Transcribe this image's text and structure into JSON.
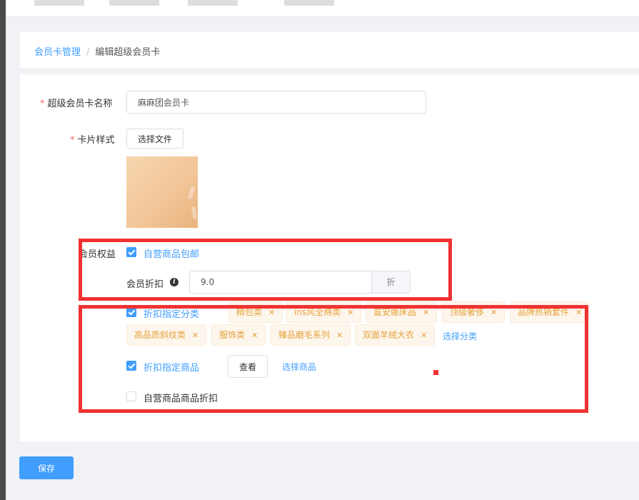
{
  "breadcrumb": {
    "parent": "会员卡管理",
    "separator": "/",
    "current": "编辑超级会员卡"
  },
  "form": {
    "required_mark": "*",
    "name_label": "超级会员卡名称",
    "name_value": "麻麻团会员卡",
    "style_label": "卡片样式",
    "choose_file_label": "选择文件",
    "benefits_label": "会员权益",
    "free_shipping": {
      "label": "自营商品包邮",
      "checked": true
    },
    "discount_label": "会员折扣",
    "info_icon_glyph": "i",
    "discount_value": "9.0",
    "discount_suffix": "折",
    "category_discount": {
      "label": "折扣指定分类",
      "checked": true
    },
    "category_tags": [
      "精包类",
      "ins风全棉类",
      "富安娜床品",
      "顶级奢侈",
      "品牌热销套件",
      "高品质斜纹类",
      "服饰类",
      "臻品磨毛系列",
      "双面羊绒大衣"
    ],
    "tag_close_glyph": "✕",
    "choose_category_label": "选择分类",
    "product_discount": {
      "label": "折扣指定商品",
      "checked": true
    },
    "view_button_label": "查看",
    "choose_product_label": "选择商品",
    "self_product_discount": {
      "label": "自营商品商品折扣",
      "checked": false
    }
  },
  "actions": {
    "save_label": "保存"
  },
  "colors": {
    "primary": "#409eff",
    "required": "#f56c6c",
    "tag_text": "#e6a23c",
    "tag_bg": "#fdf6ec",
    "highlight": "#f03232"
  }
}
